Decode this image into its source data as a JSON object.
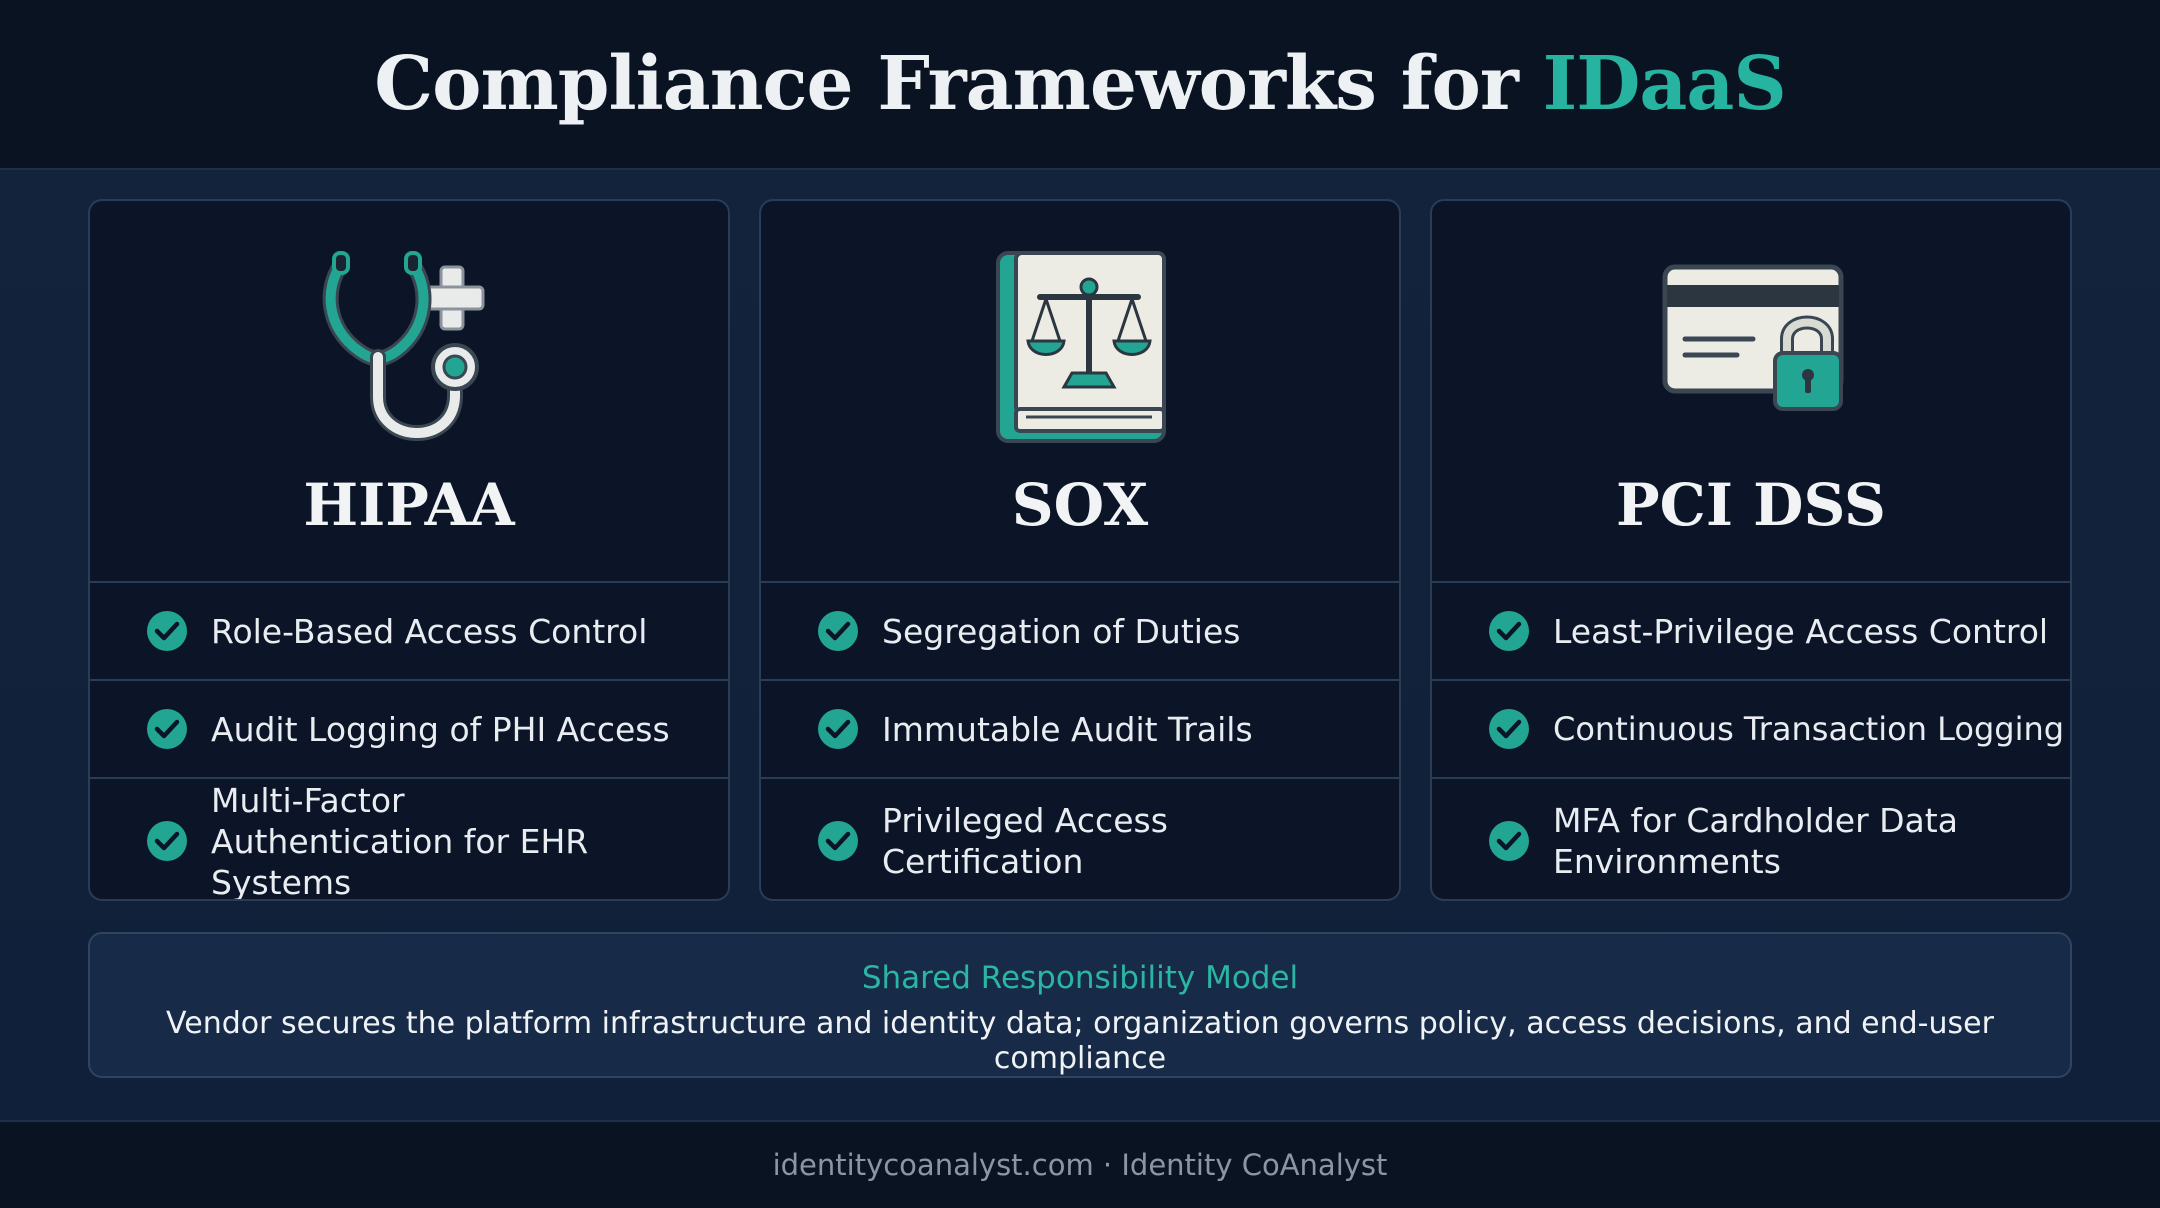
{
  "header": {
    "title_main": "Compliance Frameworks for ",
    "title_accent": "IDaaS"
  },
  "colors": {
    "accent": "#26b3a0",
    "background": "#0b1424",
    "card_background": "#0b1527",
    "card_border": "#2a3d56",
    "text": "#e9edf1"
  },
  "cards": [
    {
      "title": "HIPAA",
      "icon": "stethoscope-plus-icon",
      "items": [
        "Role-Based Access Control",
        "Audit Logging of PHI Access",
        "Multi-Factor Authentication for EHR Systems"
      ]
    },
    {
      "title": "SOX",
      "icon": "scales-book-icon",
      "items": [
        "Segregation of Duties",
        "Immutable Audit Trails",
        "Privileged Access Certification"
      ]
    },
    {
      "title": "PCI DSS",
      "icon": "credit-card-lock-icon",
      "items": [
        "Least-Privilege Access Control",
        "Continuous Transaction Logging",
        "MFA for Cardholder Data Environments"
      ]
    }
  ],
  "shared": {
    "title": "Shared Responsibility Model",
    "text": "Vendor secures the platform infrastructure and identity data; organization governs policy, access decisions, and end-user compliance"
  },
  "footer": {
    "text": "identitycoanalyst.com · Identity CoAnalyst"
  }
}
